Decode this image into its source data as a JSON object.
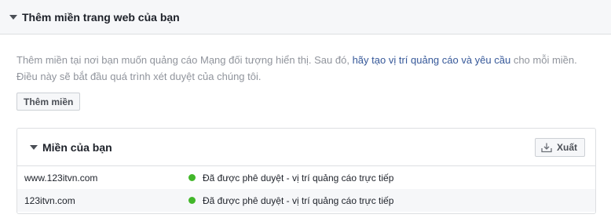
{
  "section": {
    "title": "Thêm miền trang web của bạn"
  },
  "description": {
    "before_link": "Thêm miền tại nơi bạn muốn quảng cáo Mạng đối tượng hiển thị. Sau đó, ",
    "link": "hãy tạo vị trí quảng cáo và yêu cầu",
    "after_link": " cho mỗi miền. Điều này sẽ bắt đầu quá trình xét duyệt của chúng tôi."
  },
  "add_button": "Thêm miền",
  "panel": {
    "title": "Miền của bạn",
    "export_label": "Xuất",
    "rows": [
      {
        "domain": "www.123itvn.com",
        "status": "Đã được phê duyệt - vị trí quảng cáo trực tiếp"
      },
      {
        "domain": "123itvn.com",
        "status": "Đã được phê duyệt - vị trí quảng cáo trực tiếp"
      }
    ]
  },
  "colors": {
    "status_approved": "#42b72a",
    "link": "#365899"
  }
}
